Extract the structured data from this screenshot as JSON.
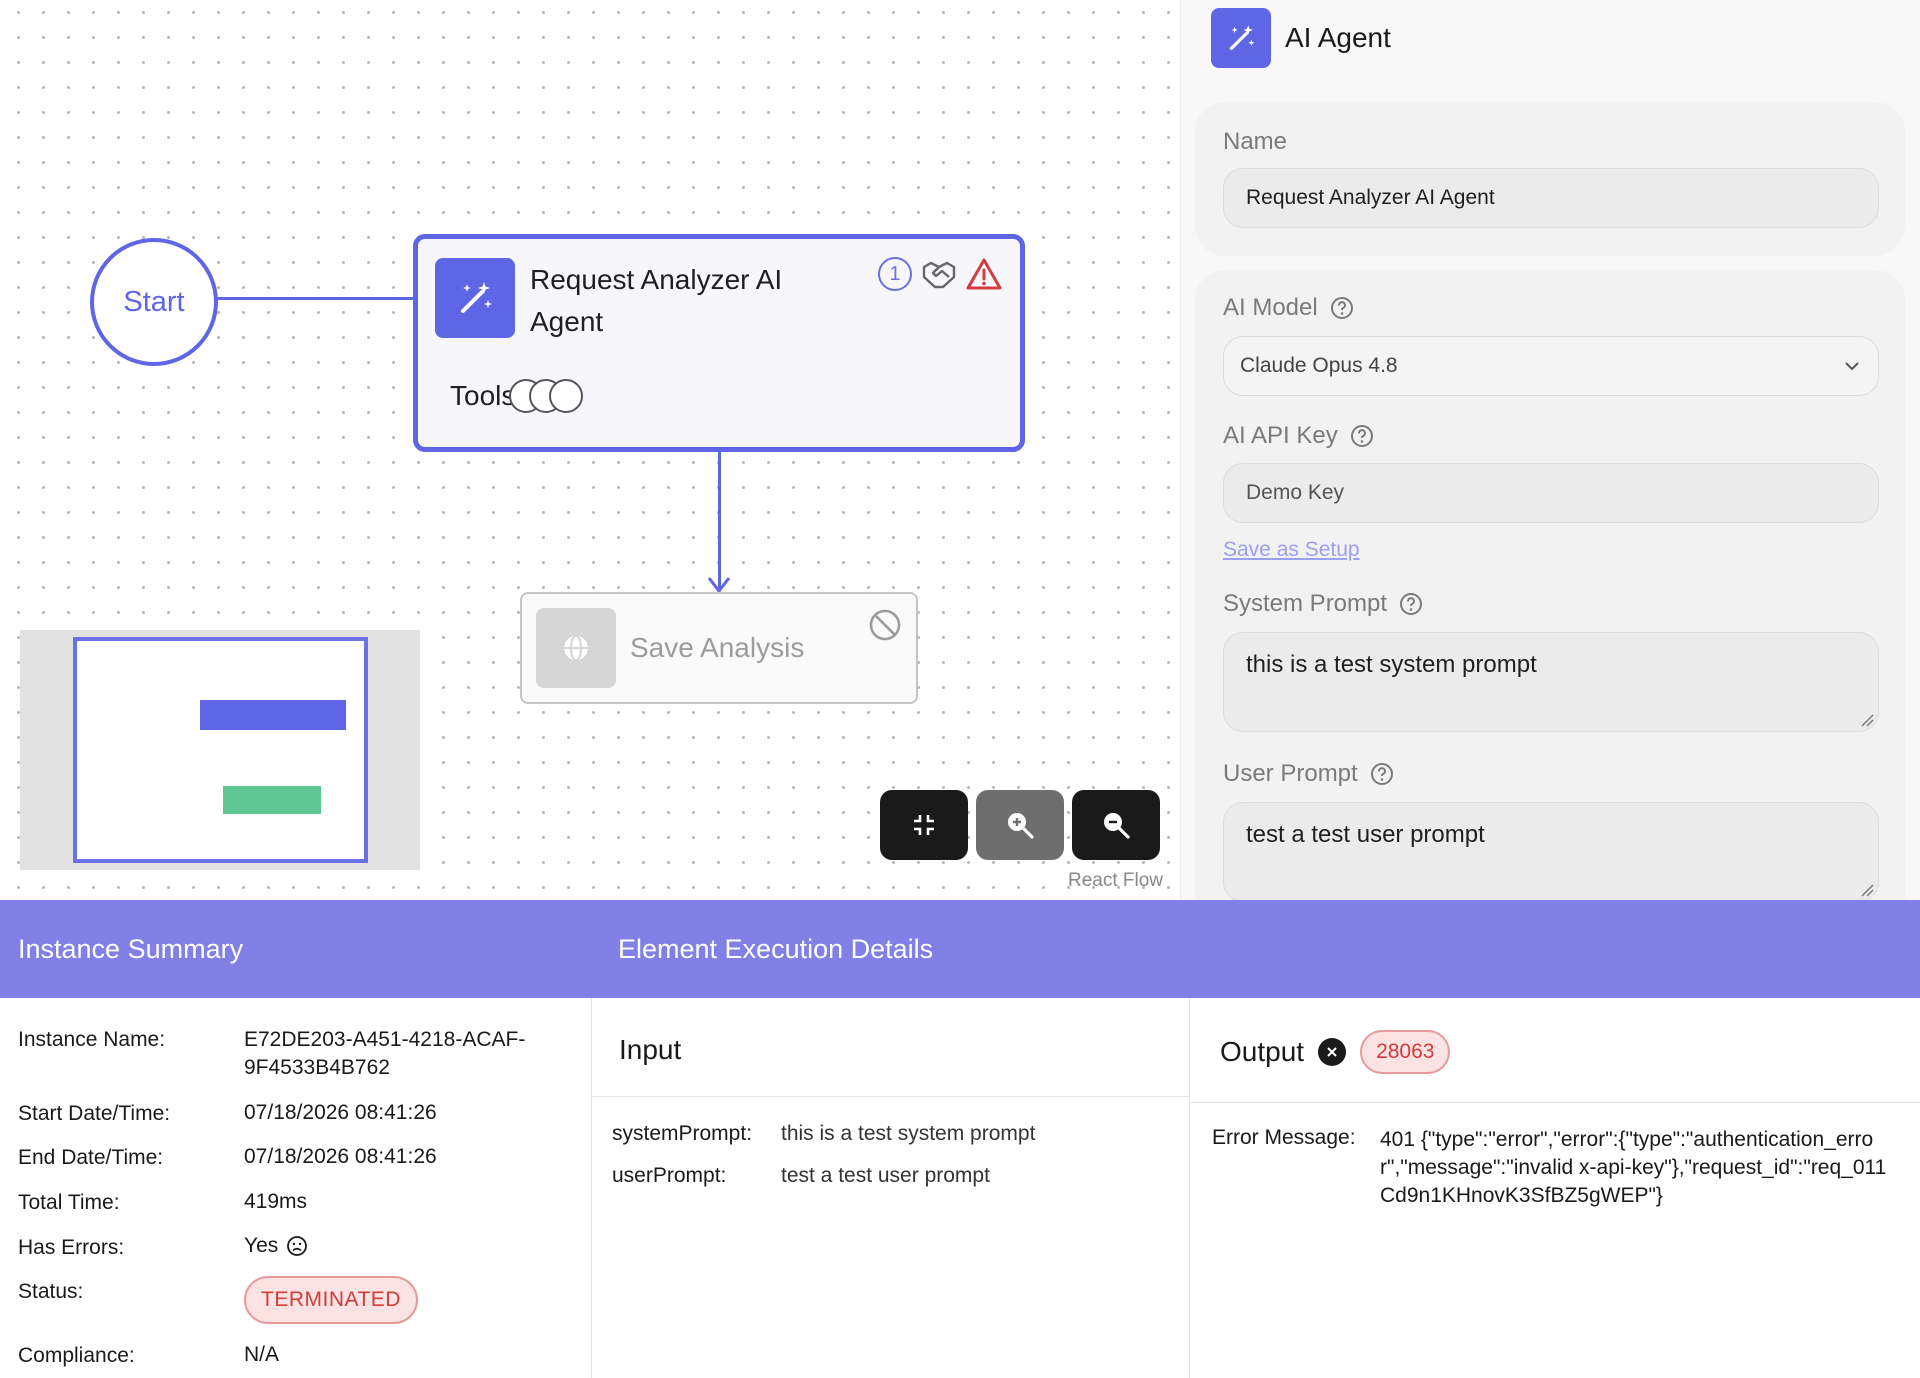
{
  "canvas": {
    "start_label": "Start",
    "agent_node": {
      "title": "Request Analyzer AI Agent",
      "badge_count": "1",
      "tools_label": "Tools"
    },
    "save_node": {
      "title": "Save Analysis"
    },
    "attribution": "React Flow",
    "icons": {
      "agent": "magic-wand-icon",
      "warning": "warning-triangle-icon",
      "handshake": "handshake-icon",
      "save": "globe-icon",
      "disabled": "disabled-icon"
    }
  },
  "panel": {
    "title": "AI Agent",
    "name_label": "Name",
    "name_value": "Request Analyzer AI Agent",
    "model_label": "AI Model",
    "model_value": "Claude Opus 4.8",
    "api_key_label": "AI API Key",
    "api_key_value": "Demo Key",
    "save_setup_link": "Save as Setup",
    "system_prompt_label": "System Prompt",
    "system_prompt_value": "this is a test system prompt",
    "user_prompt_label": "User Prompt",
    "user_prompt_value": "test a test user prompt"
  },
  "bottom": {
    "summary_title": "Instance Summary",
    "details_title": "Element Execution Details",
    "summary": {
      "instance_name_label": "Instance Name:",
      "instance_name": "E72DE203-A451-4218-ACAF-9F4533B4B762",
      "start_label": "Start Date/Time:",
      "start_value": "07/18/2026 08:41:26",
      "end_label": "End Date/Time:",
      "end_value": "07/18/2026 08:41:26",
      "total_label": "Total Time:",
      "total_value": "419ms",
      "errors_label": "Has Errors:",
      "errors_value": "Yes",
      "status_label": "Status:",
      "status_value": "TERMINATED",
      "compliance_label": "Compliance:",
      "compliance_value": "N/A"
    },
    "input": {
      "title": "Input",
      "rows": [
        {
          "key": "systemPrompt:",
          "value": "this is a test system prompt"
        },
        {
          "key": "userPrompt:",
          "value": "test a test user prompt"
        }
      ]
    },
    "output": {
      "title": "Output",
      "code": "28063",
      "error_label": "Error Message:",
      "error_value": "401 {\"type\":\"error\",\"error\":{\"type\":\"authentication_error\",\"message\":\"invalid x-api-key\"},\"request_id\":\"req_011Cd9n1KHnovK3SfBZ5gWEP\"}"
    }
  },
  "colors": {
    "accent": "#5f66e6",
    "header": "#8080e6",
    "error": "#d23c3c",
    "minimap_save": "#5fc592"
  }
}
